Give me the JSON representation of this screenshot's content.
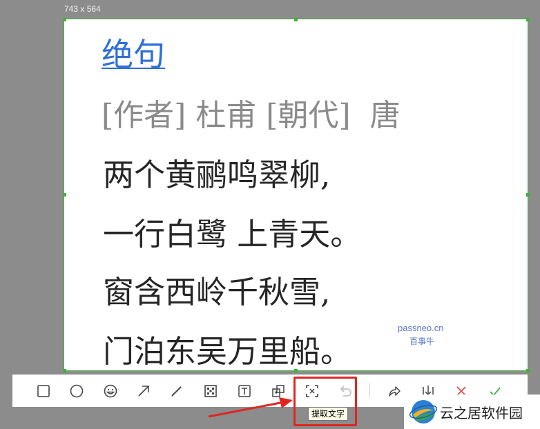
{
  "capture": {
    "size_label": "743 x 564",
    "accent_color": "#3cb43c"
  },
  "poem": {
    "title": "绝句",
    "meta": "[作者] 杜甫 [朝代]  唐",
    "lines": [
      "两个黄鹂鸣翠柳,",
      "一行白鹭 上青天。",
      "窗含西岭千秋雪,",
      "门泊东吴万里船。"
    ]
  },
  "watermark": {
    "site": "passneo.cn",
    "name": "百事牛"
  },
  "toolbar": {
    "tools": [
      {
        "name": "rectangle",
        "icon": "rectangle-icon"
      },
      {
        "name": "ellipse",
        "icon": "ellipse-icon"
      },
      {
        "name": "emoji",
        "icon": "emoji-icon"
      },
      {
        "name": "arrow",
        "icon": "arrow-icon"
      },
      {
        "name": "pen",
        "icon": "pen-icon"
      },
      {
        "name": "mosaic",
        "icon": "mosaic-icon"
      },
      {
        "name": "text",
        "icon": "text-icon"
      },
      {
        "name": "sticker",
        "icon": "sticker-icon"
      },
      {
        "name": "extract-text",
        "icon": "extract-text-icon"
      },
      {
        "name": "undo",
        "icon": "undo-icon"
      },
      {
        "name": "share",
        "icon": "share-icon"
      },
      {
        "name": "save",
        "icon": "save-icon"
      },
      {
        "name": "cancel",
        "icon": "close-icon"
      },
      {
        "name": "confirm",
        "icon": "check-icon"
      }
    ],
    "tooltip": "提取文字",
    "highlight_color": "#e0261f",
    "cancel_color": "#e84a4a",
    "confirm_color": "#3cb43c"
  },
  "logo": {
    "text": "云之居软件园"
  }
}
